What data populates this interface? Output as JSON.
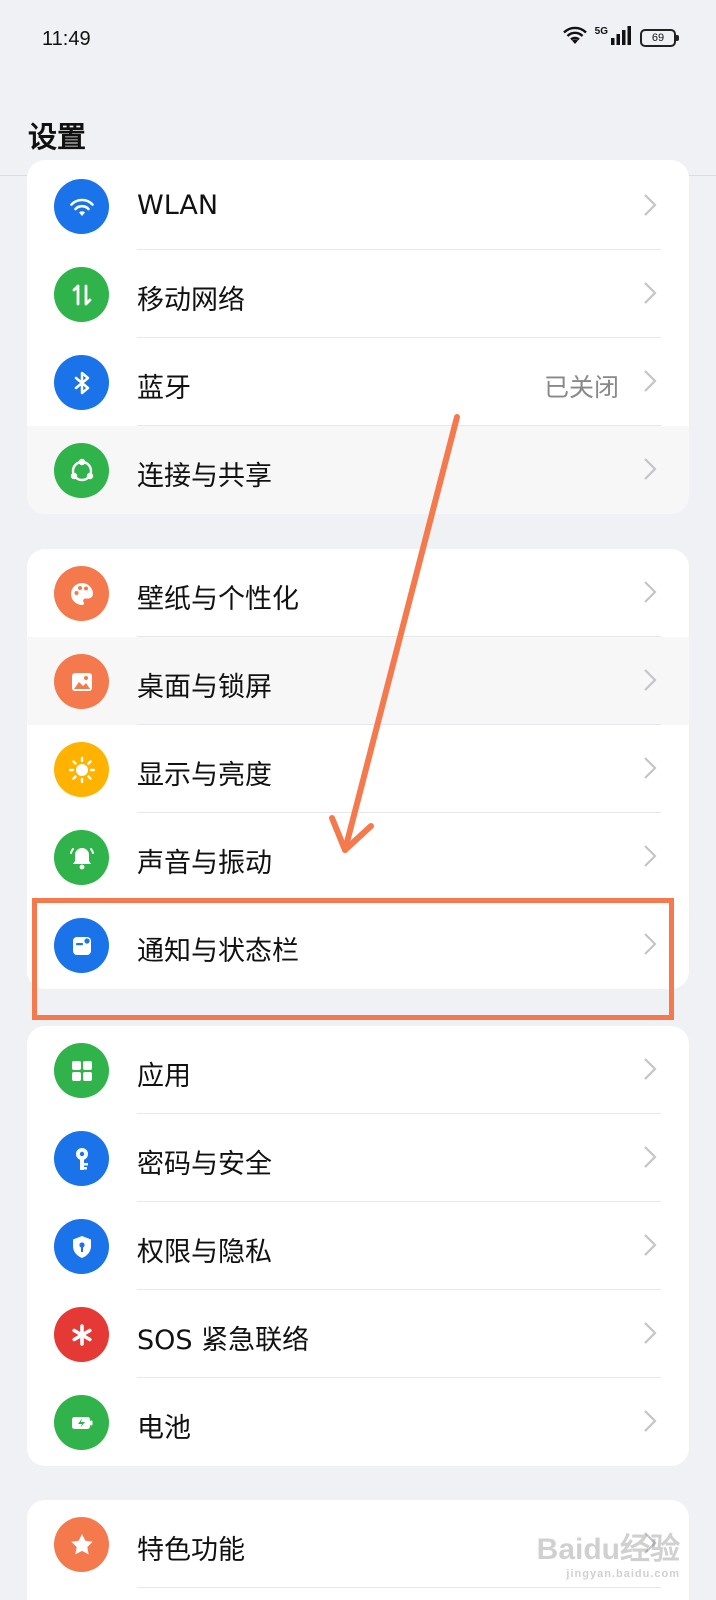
{
  "status_bar": {
    "time": "11:49",
    "network_label": "5G",
    "battery": "69"
  },
  "page": {
    "title": "设置"
  },
  "groups": [
    {
      "items": [
        {
          "label": "WLAN",
          "icon": "wifi-icon",
          "color": "#1a73e8"
        },
        {
          "label": "移动网络",
          "icon": "mobile-data-icon",
          "color": "#2fb34a"
        },
        {
          "label": "蓝牙",
          "icon": "bluetooth-icon",
          "color": "#1a73e8",
          "value": "已关闭"
        },
        {
          "label": "连接与共享",
          "icon": "share-icon",
          "color": "#2fb34a"
        }
      ]
    },
    {
      "items": [
        {
          "label": "壁纸与个性化",
          "icon": "palette-icon",
          "color": "#f47a4e"
        },
        {
          "label": "桌面与锁屏",
          "icon": "image-icon",
          "color": "#f47a4e"
        },
        {
          "label": "显示与亮度",
          "icon": "sun-icon",
          "color": "#ffb300"
        },
        {
          "label": "声音与振动",
          "icon": "bell-icon",
          "color": "#2fb34a"
        },
        {
          "label": "通知与状态栏",
          "icon": "notification-icon",
          "color": "#1a73e8"
        }
      ]
    },
    {
      "items": [
        {
          "label": "应用",
          "icon": "apps-icon",
          "color": "#2fb34a"
        },
        {
          "label": "密码与安全",
          "icon": "key-icon",
          "color": "#1a73e8"
        },
        {
          "label": "权限与隐私",
          "icon": "shield-icon",
          "color": "#1a73e8"
        },
        {
          "label": "SOS 紧急联络",
          "icon": "sos-icon",
          "color": "#e53935"
        },
        {
          "label": "电池",
          "icon": "battery-icon",
          "color": "#2fb34a"
        }
      ]
    },
    {
      "items": [
        {
          "label": "特色功能",
          "icon": "star-icon",
          "color": "#f47a4e"
        }
      ]
    }
  ],
  "annotation": {
    "color": "#f47a4e"
  },
  "watermark": {
    "text": "Baidu经验",
    "sub": "jingyan.baidu.com"
  }
}
